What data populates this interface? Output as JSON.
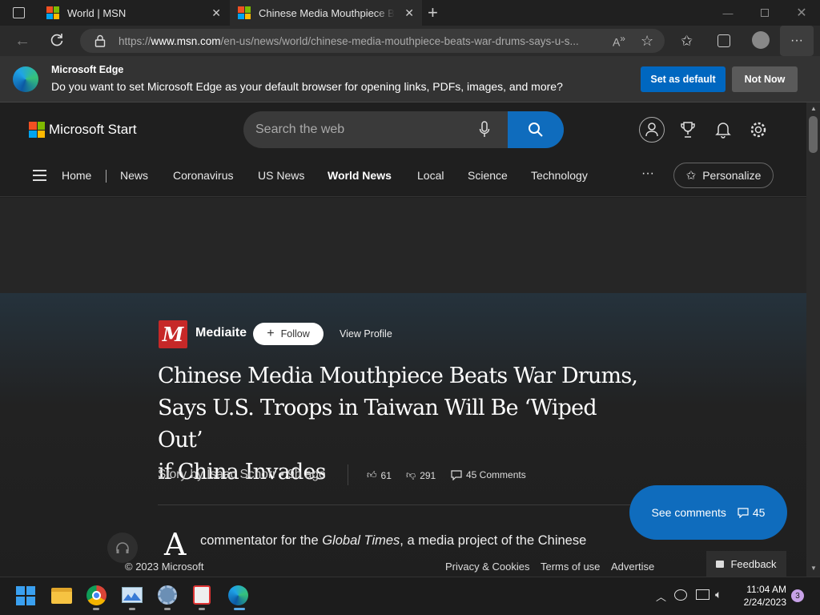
{
  "browser": {
    "tabs": [
      {
        "title": "World | MSN"
      },
      {
        "title": "Chinese Media Mouthpiece Beats War Drums, Says U.S. Troops in Taiwan Will Be 'Wiped Out' if China Invades"
      }
    ],
    "url_prefix": "https://",
    "url_domain": "www.msn.com",
    "url_path": "/en-us/news/world/chinese-media-mouthpiece-beats-war-drums-says-u-s..."
  },
  "banner": {
    "title": "Microsoft Edge",
    "message": "Do you want to set Microsoft Edge as your default browser for opening links, PDFs, images, and more?",
    "set_default_label": "Set as default",
    "not_now_label": "Not Now"
  },
  "msn": {
    "brand": "Microsoft Start",
    "search_placeholder": "Search the web",
    "nav": [
      "Home",
      "News",
      "Coronavirus",
      "US News",
      "World News",
      "Local",
      "Science",
      "Technology"
    ],
    "active_nav": "World News",
    "more_label": "···",
    "personalize_label": "Personalize"
  },
  "article": {
    "publisher": "Mediaite",
    "publisher_logo_letter": "M",
    "follow_label": "Follow",
    "view_profile_label": "View Profile",
    "headline_line1": "Chinese Media Mouthpiece Beats War Drums,",
    "headline_line2": "Says U.S. Troops in Taiwan Will Be ‘Wiped Out’",
    "headline_line3": "if China Invades",
    "byline": "Story by Isaac Schorr • 9h ago",
    "likes": "61",
    "dislikes": "291",
    "comments_label": "45 Comments",
    "dropcap": "A",
    "body_pre": "commentator for the ",
    "body_italic": "Global Times",
    "body_post": ", a media project of the Chinese",
    "see_comments_label": "See comments",
    "see_comments_count": "45"
  },
  "footer": {
    "copyright": "© 2023 Microsoft",
    "privacy": "Privacy & Cookies",
    "terms": "Terms of use",
    "advertise": "Advertise",
    "feedback": "Feedback"
  },
  "taskbar": {
    "time": "11:04 AM",
    "date": "2/24/2023",
    "notification_count": "3"
  },
  "colors": {
    "accent": "#0f6cbd",
    "banner_button": "#0067c0",
    "publisher_red": "#c62828"
  }
}
